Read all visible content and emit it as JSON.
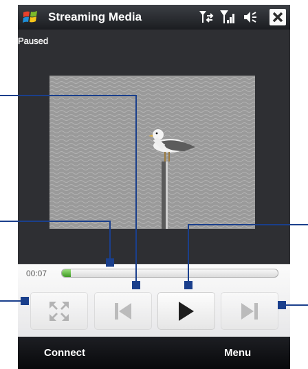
{
  "titlebar": {
    "title": "Streaming Media",
    "icons": [
      "windows-logo",
      "connectivity-icon",
      "signal-icon",
      "volume-icon",
      "close-icon"
    ]
  },
  "screen": {
    "status": "Paused",
    "video_content": "seagull-on-post"
  },
  "controls": {
    "elapsed": "00:07",
    "progress": 0.04,
    "buttons": [
      "full-screen",
      "previous",
      "play",
      "next"
    ],
    "accent_color": "#3f9a24"
  },
  "softkeys": {
    "left": "Connect",
    "right": "Menu"
  }
}
